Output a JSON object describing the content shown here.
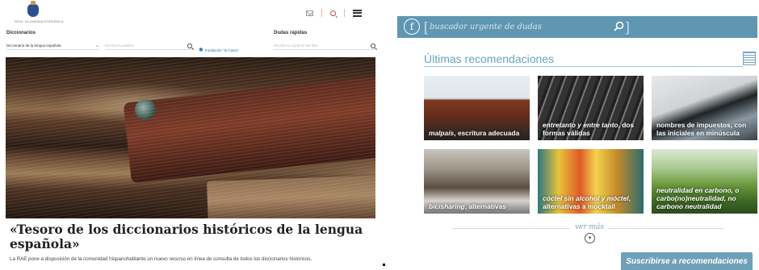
{
  "rae": {
    "logo_text": "REAL ACADEMIA ESPAÑOLA",
    "dic_label": "Diccionarios",
    "dudas_label": "Dudas rápidas",
    "dic_select_value": "Diccionario de la lengua española",
    "dic_input_placeholder": "Escriba la palabra",
    "dudas_input_placeholder": "Escriba su duda en las filas",
    "fundacion": "Fundación “la Caixa”",
    "news_title": "«Tesoro de los diccionarios históricos de la lengua española»",
    "news_sub": "La RAE pone a disposición de la comunidad hispanohablante un nuevo recurso en línea de consulta de todos los diccionarios históricos."
  },
  "fundeu": {
    "search_placeholder": "buscador urgente de dudas",
    "recommendations_title": "Últimas recomendaciones",
    "cards": [
      {
        "em": "malpaís",
        "rest": ", escritura adecuada"
      },
      {
        "em": "entretanto y entre tanto",
        "rest": ", dos formas válidas"
      },
      {
        "em": "",
        "rest": "nombres de impuestos, con las iniciales en minúscula"
      },
      {
        "em": "bicisharing",
        "rest": ", alternativas"
      },
      {
        "em": "cóctel sin alcohol y móctel",
        "rest": ", alternativas a mocktail"
      },
      {
        "em": "neutralidad en carbono, o carbo(no)neutralidad, no carbono neutralidad",
        "rest": ""
      }
    ],
    "ver_mas": "ver más",
    "subscribe": "Suscribirse a recomendaciones"
  }
}
